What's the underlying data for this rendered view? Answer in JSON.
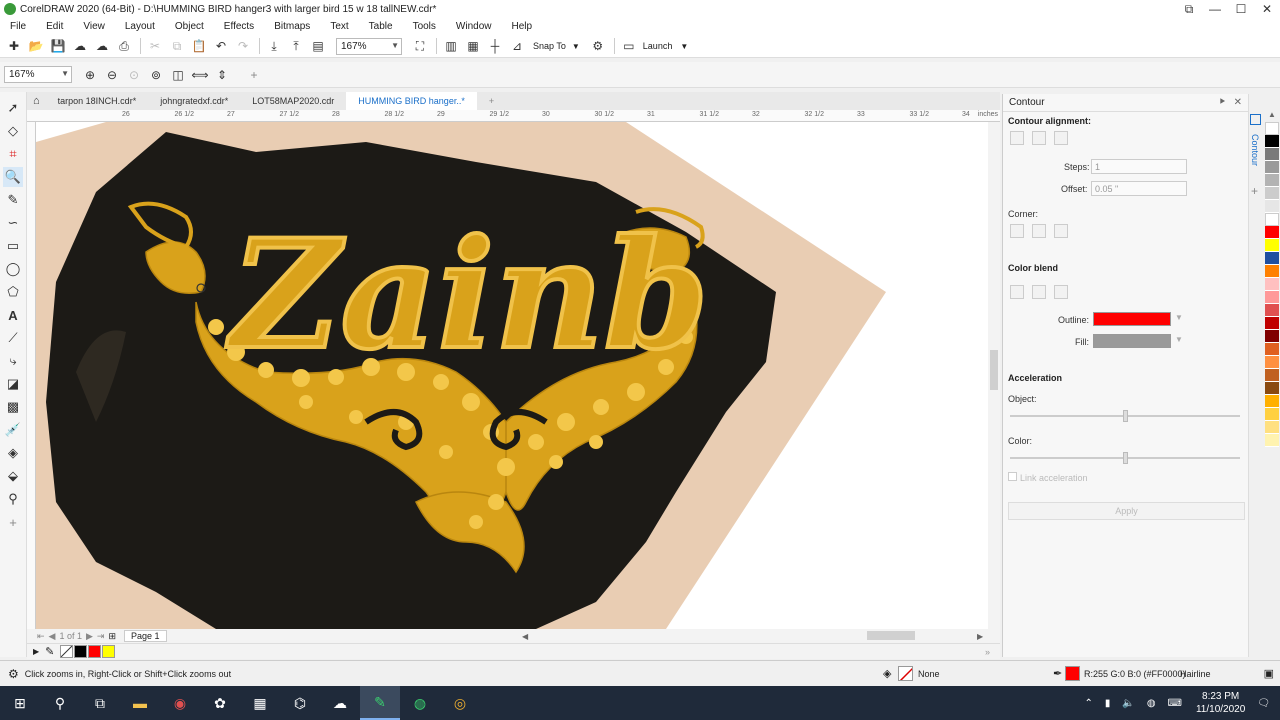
{
  "window": {
    "title": "CorelDRAW 2020 (64-Bit) - D:\\HUMMING BIRD hanger3 with larger bird 15 w 18 tallNEW.cdr*",
    "controls": [
      "⧉",
      "—",
      "☐",
      "✕"
    ]
  },
  "menu": [
    "File",
    "Edit",
    "View",
    "Layout",
    "Object",
    "Effects",
    "Bitmaps",
    "Text",
    "Table",
    "Tools",
    "Window",
    "Help"
  ],
  "toolbar": {
    "zoom_value": "167%",
    "snap_to_label": "Snap To",
    "launch_label": "Launch"
  },
  "property_bar": {
    "zoom_value": "167%"
  },
  "doc_tabs": [
    {
      "label": "tarpon 18INCH.cdr*",
      "active": false
    },
    {
      "label": "johngratedxf.cdr*",
      "active": false
    },
    {
      "label": "LOT58MAP2020.cdr",
      "active": false
    },
    {
      "label": "HUMMING BIRD hanger..*",
      "active": true
    }
  ],
  "ruler": {
    "labels": [
      "26",
      "26 1/2",
      "27",
      "27 1/2",
      "28",
      "28 1/2",
      "29",
      "29 1/2",
      "30",
      "30 1/2",
      "31",
      "31 1/2",
      "32",
      "32 1/2",
      "33",
      "33 1/2",
      "34"
    ],
    "units": "inches"
  },
  "page_nav": {
    "counter": "1 of 1",
    "page_label": "Page 1"
  },
  "docker": {
    "title": "Contour",
    "contour_alignment": "Contour alignment:",
    "steps_label": "Steps:",
    "steps_value": "1",
    "offset_label": "Offset:",
    "offset_value": "0.05 \"",
    "corner_label": "Corner:",
    "color_blend": "Color blend",
    "outline_label": "Outline:",
    "fill_label": "Fill:",
    "outline_color": "#ff0000",
    "fill_color": "#9a9a9a",
    "acceleration": "Acceleration",
    "object_label": "Object:",
    "color_label": "Color:",
    "link_acceleration": "Link acceleration",
    "apply_label": "Apply",
    "side_tab": "Contour"
  },
  "artwork": {
    "text": "Zainb",
    "gold": "#d9a21b",
    "gold_light": "#f3c74a",
    "background": "#000000"
  },
  "palette_colors": [
    "#ffffff",
    "#000000",
    "#7a7a7a",
    "#9a9a9a",
    "#b3b3b3",
    "#cccccc",
    "#e6e6e6",
    "#ffffff",
    "#ff0000",
    "#ffff00",
    "#1f4fa0",
    "#ff8000",
    "#ffc0c0",
    "#ff9999",
    "#e05050",
    "#c00000",
    "#800000",
    "#e06020",
    "#ff9040",
    "#c06020",
    "#8a4a10",
    "#ffb000",
    "#ffd040",
    "#ffe080",
    "#fff3b0"
  ],
  "quick_swatches": [
    "#ffffff",
    "#000000",
    "#ff0000",
    "#ffff00"
  ],
  "status": {
    "hint": "Click zooms in, Right-Click or Shift+Click zooms out",
    "fill_none": "None",
    "outline_info": "R:255 G:0 B:0 (#FF0000)",
    "outline_width": "Hairline",
    "outline_color": "#ff0000"
  },
  "taskbar": {
    "time": "8:23 PM",
    "date": "11/10/2020"
  }
}
